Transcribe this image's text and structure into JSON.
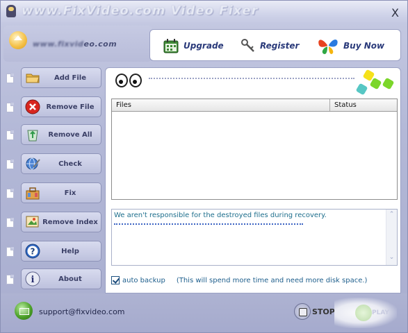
{
  "window": {
    "title": "www.FixVideo.com Video Fixer",
    "close_label": "X"
  },
  "logo": {
    "site_prefix": "www.fixvid",
    "site_suffix": "eo.com"
  },
  "actions": {
    "upgrade": "Upgrade",
    "register": "Register",
    "buy_now": "Buy Now"
  },
  "menu": [
    {
      "label": "Add File",
      "icon": "folder-icon"
    },
    {
      "label": "Remove File",
      "icon": "remove-x-icon"
    },
    {
      "label": "Remove All",
      "icon": "recycle-bin-icon"
    },
    {
      "label": "Check",
      "icon": "globe-check-icon"
    },
    {
      "label": "Fix",
      "icon": "toolbox-icon"
    },
    {
      "label": "Remove Index",
      "icon": "index-image-icon"
    },
    {
      "label": "Help",
      "icon": "question-icon"
    },
    {
      "label": "About",
      "icon": "info-icon"
    }
  ],
  "table": {
    "columns": [
      "Files",
      "Status"
    ]
  },
  "log": {
    "message": "We aren't responsible for the destroyed files during recovery."
  },
  "backup": {
    "checked": true,
    "label": "auto backup",
    "note": "(This will spend more time and need more disk space.)"
  },
  "footer": {
    "email": "support@fixvideo.com",
    "stop_label": "STOP",
    "play_label": "PLAY"
  },
  "colors": {
    "accent": "#2a3a7a",
    "log_text": "#1d6e8c",
    "panel_bg": "#aab0ce"
  }
}
